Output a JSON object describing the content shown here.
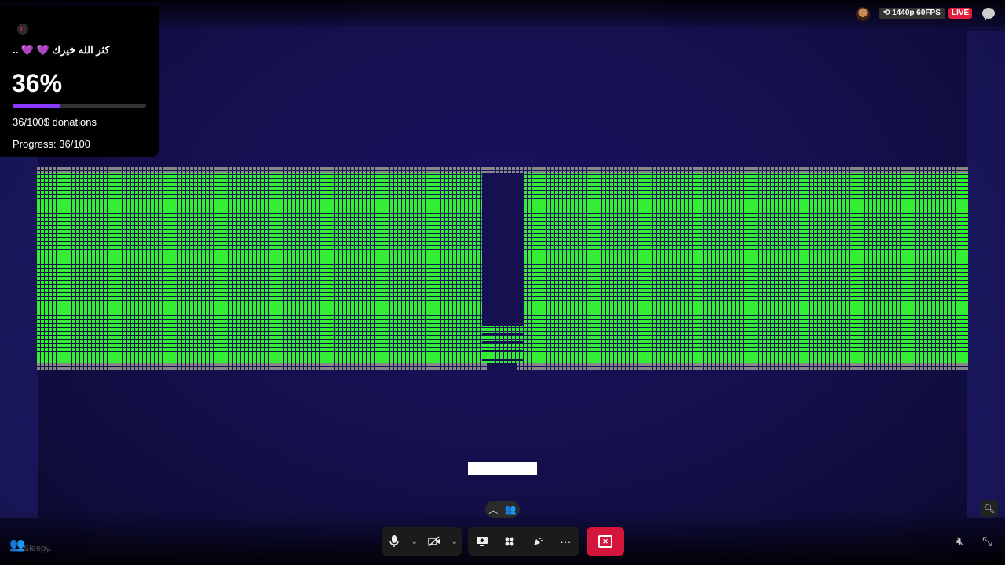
{
  "widget": {
    "logo_letter": "C",
    "message": "كثر الله خيرك 💜 💜 ..",
    "percent_text": "36%",
    "progress_fraction": 0.36,
    "donations_text": "36/100$ donations",
    "progress_text": "Progress: 36/100"
  },
  "stream": {
    "quality": "⟲ 1440p 60FPS",
    "live": "LIVE"
  },
  "game": {
    "brick_color": "#33ee33",
    "border_color": "#888888",
    "background_color": "#15104f",
    "paddle_color": "#ffffff"
  },
  "controls": {
    "mic_icon": "microphone-icon",
    "camera_off_icon": "camera-off-icon",
    "share_icon": "screen-share-icon",
    "apps_icon": "apps-icon",
    "reactions_icon": "reactions-icon",
    "more_label": "···",
    "leave_icon": "leave-icon"
  },
  "bottom_left": {
    "name": "Sleepy."
  }
}
